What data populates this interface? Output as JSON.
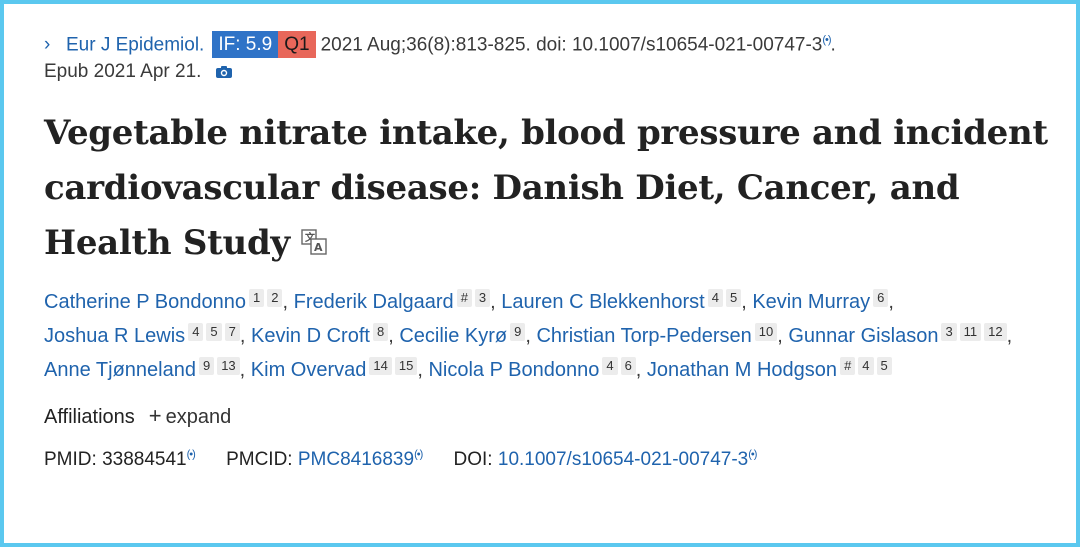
{
  "citation": {
    "journal": "Eur J Epidemiol.",
    "impact_factor": "IF: 5.9",
    "quartile": "Q1",
    "details": "2021 Aug;36(8):813-825. doi: 10.1007/s10654-021-00747-3",
    "line2": "Epub 2021 Apr 21."
  },
  "title_lines": [
    "Vegetable nitrate intake, blood pressure and incident",
    "cardiovascular disease: Danish Diet, Cancer, and",
    "Health Study"
  ],
  "authors": [
    {
      "name": "Catherine P Bondonno",
      "sups": [
        "1",
        "2"
      ]
    },
    {
      "name": "Frederik Dalgaard",
      "sups": [
        "#",
        "3"
      ]
    },
    {
      "name": "Lauren C Blekkenhorst",
      "sups": [
        "4",
        "5"
      ]
    },
    {
      "name": "Kevin Murray",
      "sups": [
        "6"
      ]
    },
    {
      "name": "Joshua R Lewis",
      "sups": [
        "4",
        "5",
        "7"
      ]
    },
    {
      "name": "Kevin D Croft",
      "sups": [
        "8"
      ]
    },
    {
      "name": "Cecilie Kyrø",
      "sups": [
        "9"
      ]
    },
    {
      "name": "Christian Torp-Pedersen",
      "sups": [
        "10"
      ]
    },
    {
      "name": "Gunnar Gislason",
      "sups": [
        "3",
        "11",
        "12"
      ]
    },
    {
      "name": "Anne Tjønneland",
      "sups": [
        "9",
        "13"
      ]
    },
    {
      "name": "Kim Overvad",
      "sups": [
        "14",
        "15"
      ]
    },
    {
      "name": "Nicola P Bondonno",
      "sups": [
        "4",
        "6"
      ]
    },
    {
      "name": "Jonathan M Hodgson",
      "sups": [
        "#",
        "4",
        "5"
      ]
    }
  ],
  "affiliations": {
    "label": "Affiliations",
    "toggle": "expand"
  },
  "identifiers": {
    "pmid_label": "PMID:",
    "pmid": "33884541",
    "pmcid_label": "PMCID:",
    "pmcid": "PMC8416839",
    "doi_label": "DOI:",
    "doi": "10.1007/s10654-021-00747-3"
  },
  "colors": {
    "link": "#1f63ad",
    "if_badge": "#2f73c7",
    "q_badge": "#e8675a",
    "frame": "#5bc8ef"
  }
}
